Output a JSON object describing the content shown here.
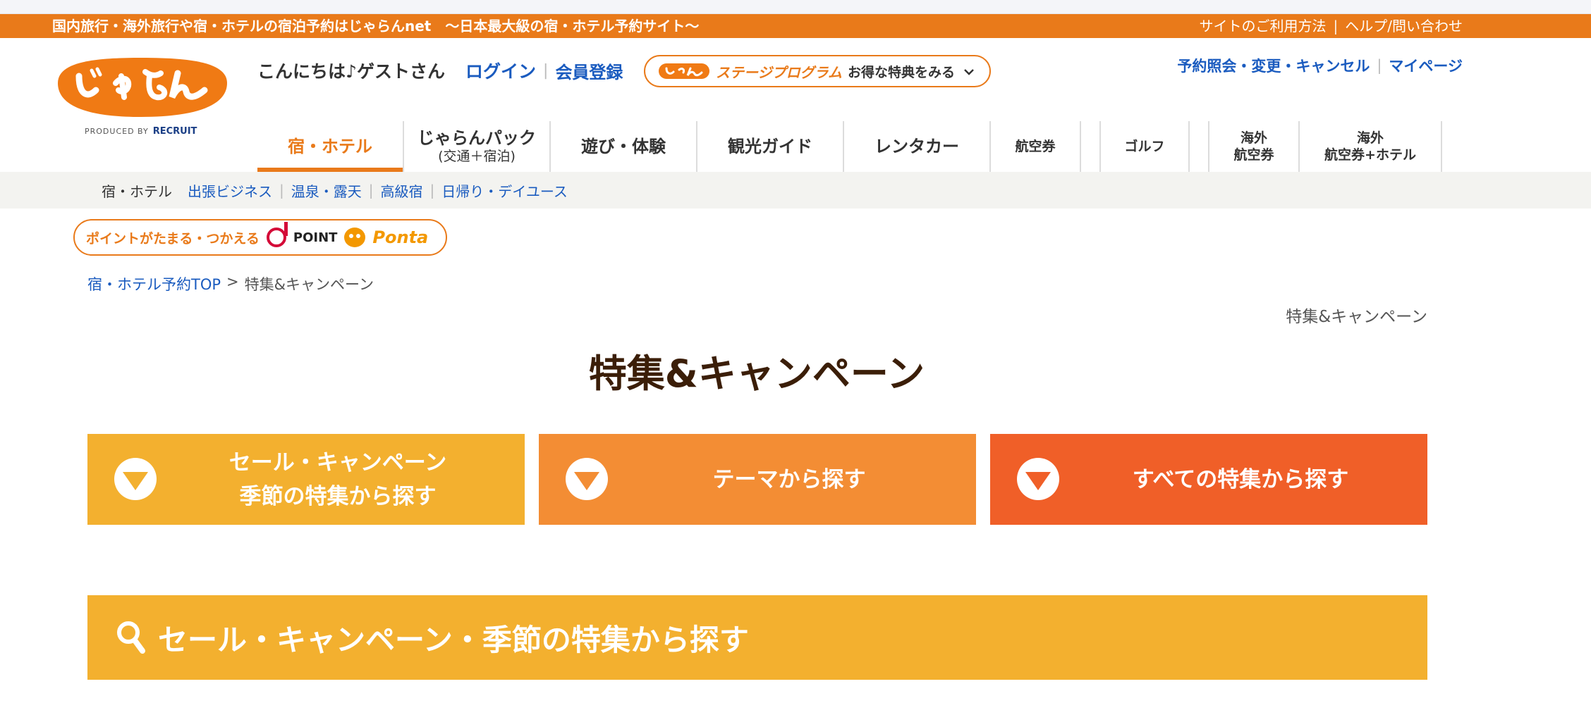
{
  "topbar": {
    "tagline": "国内旅行・海外旅行や宿・ホテルの宿泊予約はじゃらんnet　〜日本最大級の宿・ホテル予約サイト〜",
    "help_links": [
      "サイトのご利用方法",
      "ヘルプ/問い合わせ"
    ],
    "separator": "|"
  },
  "logo": {
    "alt": "じゃらん",
    "produced_by": "PRODUCED BY",
    "recruit": "RECRUIT"
  },
  "header": {
    "greeting": "こんにちは♪ゲストさん",
    "login": "ログイン",
    "register": "会員登録",
    "stage_program": "ステージプログラム",
    "stage_benefit": "お得な特典をみる",
    "utility_links": [
      "予約照会・変更・キャンセル",
      "マイページ"
    ]
  },
  "nav": {
    "items": [
      {
        "l1": "宿・ホテル",
        "l2": ""
      },
      {
        "l1": "じゃらんパック",
        "l2": "(交通＋宿泊)"
      },
      {
        "l1": "遊び・体験",
        "l2": ""
      },
      {
        "l1": "観光ガイド",
        "l2": ""
      },
      {
        "l1": "レンタカー",
        "l2": ""
      },
      {
        "l1": "航空券",
        "l2": ""
      },
      {
        "l1": "ゴルフ",
        "l2": ""
      },
      {
        "l1": "海外",
        "l2": "航空券"
      },
      {
        "l1": "海外",
        "l2": "航空券+ホテル"
      }
    ]
  },
  "subnav": {
    "current": "宿・ホテル",
    "links": [
      "出張ビジネス",
      "温泉・露天",
      "高級宿",
      "日帰り・デイユース"
    ]
  },
  "points_banner": {
    "text": "ポイントがたまる・つかえる",
    "dpoint": "POINT",
    "ponta": "Ponta"
  },
  "breadcrumb": {
    "home": "宿・ホテル予約TOP",
    "sep": ">",
    "current": "特集&キャンペーン"
  },
  "right_label": "特集&キャンペーン",
  "page_title": "特集&キャンペーン",
  "buttons": [
    {
      "line1": "セール・キャンペーン",
      "line2": "季節の特集から探す"
    },
    {
      "line1": "テーマから探す",
      "line2": ""
    },
    {
      "line1": "すべての特集から探す",
      "line2": ""
    }
  ],
  "section_heading": "セール・キャンペーン・季節の特集から探す",
  "colors": {
    "brand_orange": "#e97a1a",
    "link_blue": "#1a5bbf",
    "btn1": "#f3b02f",
    "btn2": "#f38d34",
    "btn3": "#f05f28",
    "title_brown": "#3b1e08"
  }
}
